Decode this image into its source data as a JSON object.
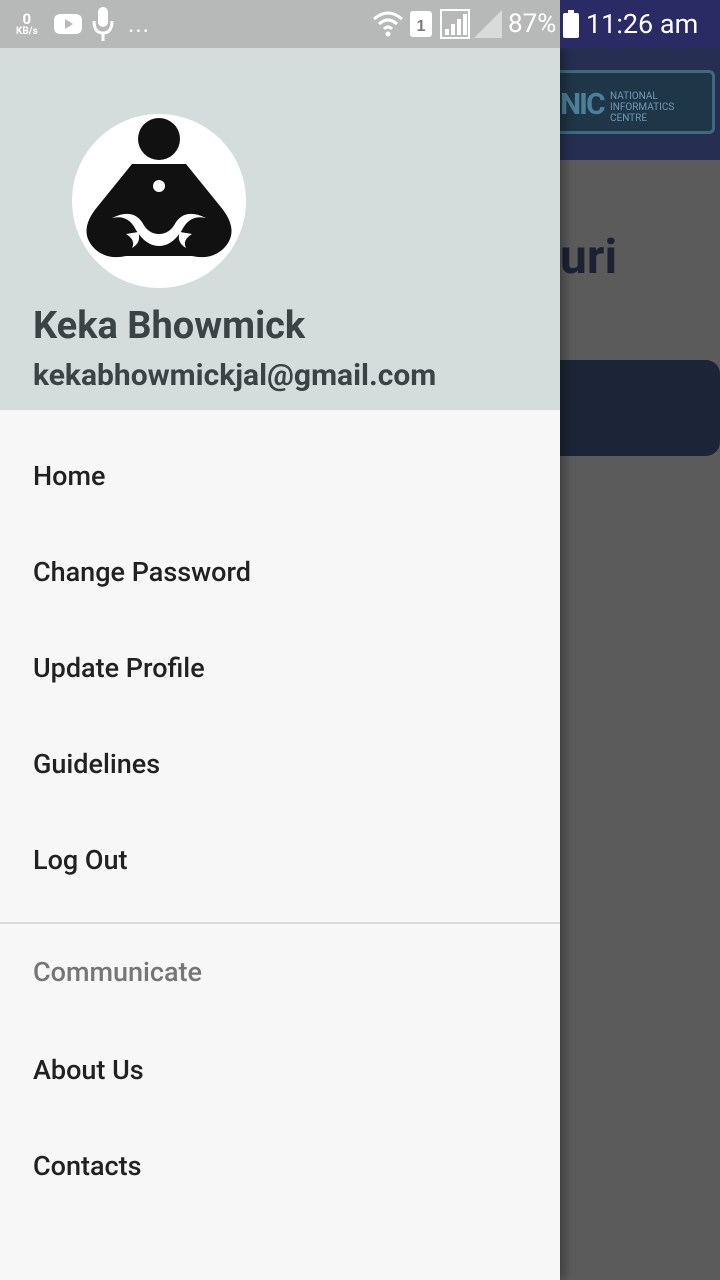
{
  "status_bar": {
    "net_speed_value": "0",
    "net_speed_unit": "KB/s",
    "overflow": "...",
    "battery_percent": "87%",
    "time": "11:26 am",
    "sim_number": "1",
    "icons": [
      "youtube-icon",
      "mic-icon",
      "wifi-icon",
      "sim-icon",
      "signal-icon",
      "signal-icon",
      "battery-icon"
    ]
  },
  "background_app": {
    "logo_text": [
      "NATIONAL",
      "INFORMATICS",
      "CENTRE"
    ],
    "title_fragment": "uri"
  },
  "drawer": {
    "user_name": "Keka Bhowmick",
    "user_email": "kekabhowmickjal@gmail.com",
    "menu": [
      {
        "label": "Home"
      },
      {
        "label": "Change Password"
      },
      {
        "label": "Update Profile"
      },
      {
        "label": "Guidelines"
      },
      {
        "label": "Log Out"
      }
    ],
    "section_header": "Communicate",
    "section_items": [
      {
        "label": "About Us"
      },
      {
        "label": "Contacts"
      }
    ]
  },
  "colors": {
    "header_bg": "#d5dcdc",
    "drawer_bg": "#f7f7f7",
    "app_bar": "#262f52",
    "scrim": "#5b5b5b"
  }
}
